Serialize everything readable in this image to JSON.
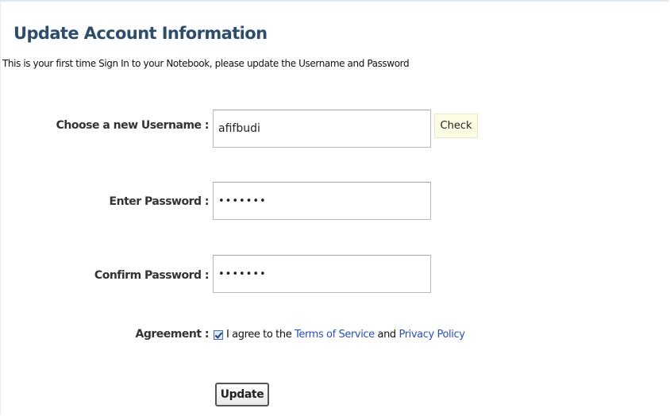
{
  "header": {
    "title": "Update Account Information",
    "subtitle": "This is your first time Sign In to your Notebook, please update the Username and Password"
  },
  "form": {
    "username": {
      "label": "Choose a new Username :",
      "value": "afifbudi",
      "check_label": "Check"
    },
    "password": {
      "label": "Enter Password :",
      "value": "•••••••"
    },
    "confirm": {
      "label": "Confirm Password :",
      "value": "•••••••"
    },
    "agreement": {
      "label": "Agreement :",
      "checked": true,
      "text_before": "I agree to the ",
      "terms_link": "Terms of Service",
      "text_and": " and ",
      "privacy_link": "Privacy Policy"
    },
    "submit_label": "Update"
  },
  "colors": {
    "title": "#2e4d6b",
    "link": "#2850b8",
    "check_button_bg": "#fdfde3"
  }
}
